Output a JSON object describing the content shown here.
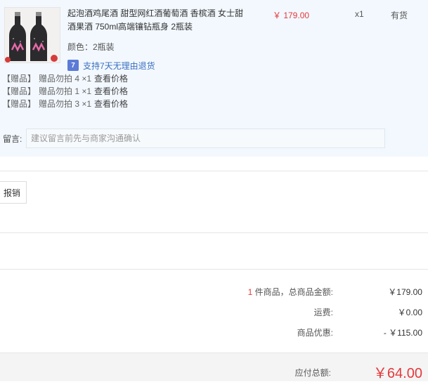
{
  "product": {
    "title": "起泡酒鸡尾酒 甜型网红酒葡萄酒 香槟酒 女士甜酒果酒 750ml高端镶钻瓶身 2瓶装",
    "price": "￥ 179.00",
    "quantity": "x1",
    "stock": "有货",
    "spec": "颜色：2瓶装",
    "return_policy": "支持7天无理由退货",
    "return_icon_char": "7"
  },
  "gifts": [
    {
      "tag": "【赠品】",
      "name": "赠品勿拍 4 ×1",
      "link": "查看价格"
    },
    {
      "tag": "【赠品】",
      "name": "赠品勿拍 1 ×1",
      "link": "查看价格"
    },
    {
      "tag": "【赠品】",
      "name": "赠品勿拍 3 ×1",
      "link": "查看价格"
    }
  ],
  "message": {
    "label": "留言:",
    "placeholder": "建议留言前先与商家沟通确认"
  },
  "invoice": {
    "label": "报销"
  },
  "summary": {
    "count": "1",
    "count_suffix": " 件商品，总商品金额:",
    "goods_total": "￥179.00",
    "shipping_label": "运费:",
    "shipping_value": "￥0.00",
    "discount_label": "商品优惠:",
    "discount_value": "- ￥115.00",
    "payable_label": "应付总额:",
    "payable_value": "￥64.00"
  },
  "colors": {
    "accent_red": "#e4393c",
    "order_bg": "#f2f8fe",
    "link_blue": "#3b6fbf"
  }
}
